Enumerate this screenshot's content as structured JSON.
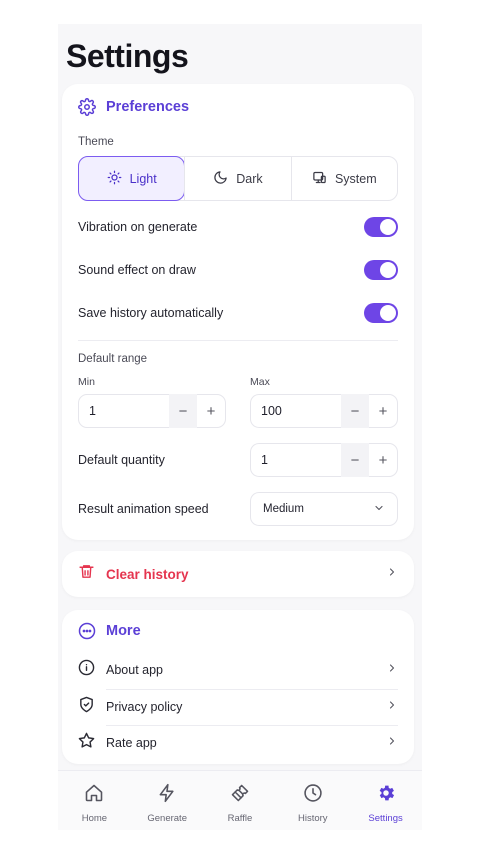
{
  "header": {
    "title": "Settings"
  },
  "preferences": {
    "title": "Preferences",
    "theme_label": "Theme",
    "theme_options": [
      "Light",
      "Dark",
      "System"
    ],
    "theme_selected": "Light",
    "toggles": [
      {
        "label": "Vibration on generate",
        "on": true
      },
      {
        "label": "Sound effect on draw",
        "on": true
      },
      {
        "label": "Save history automatically",
        "on": true
      }
    ],
    "default_range_label": "Default range",
    "min_label": "Min",
    "min_value": "1",
    "max_label": "Max",
    "max_value": "100",
    "quantity_label": "Default quantity",
    "quantity_value": "1",
    "animation_label": "Result animation speed",
    "animation_value": "Medium"
  },
  "clear": {
    "label": "Clear history"
  },
  "more": {
    "title": "More",
    "items": [
      {
        "label": "About app",
        "icon": "info-icon"
      },
      {
        "label": "Privacy policy",
        "icon": "shield-check-icon"
      },
      {
        "label": "Rate app",
        "icon": "star-icon"
      }
    ]
  },
  "tabs": [
    {
      "label": "Home",
      "icon": "home-icon"
    },
    {
      "label": "Generate",
      "icon": "bolt-icon"
    },
    {
      "label": "Raffle",
      "icon": "ticket-icon"
    },
    {
      "label": "History",
      "icon": "clock-icon"
    },
    {
      "label": "Settings",
      "icon": "gear-icon",
      "active": true
    }
  ],
  "colors": {
    "accent": "#5b3fd6",
    "toggle": "#6e45e6",
    "danger": "#e5354f"
  },
  "stepper_symbols": {
    "minus": "−",
    "plus": "+"
  }
}
